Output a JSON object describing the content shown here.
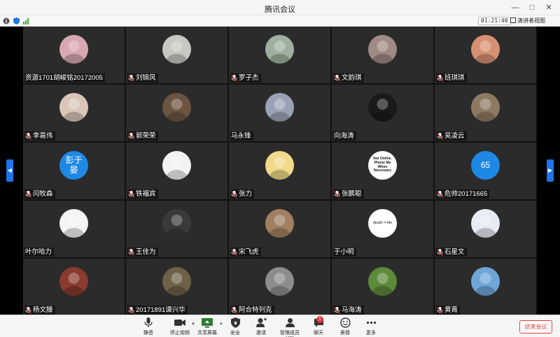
{
  "window": {
    "title": "腾讯会议"
  },
  "status": {
    "timer": "01:21:40",
    "presenter_view_label": "演讲者视图"
  },
  "participants": [
    {
      "name": "资源1701胡峻铭20172005",
      "muted": false,
      "avatar_text": "",
      "avatar_color": "#d7a7b2"
    },
    {
      "name": "刘锦风",
      "muted": true,
      "avatar_text": "",
      "avatar_color": "#c9c7c3"
    },
    {
      "name": "罗子杰",
      "muted": true,
      "avatar_text": "",
      "avatar_color": "#9fb0a1"
    },
    {
      "name": "文韵琪",
      "muted": true,
      "avatar_text": "",
      "avatar_color": "#a08a84"
    },
    {
      "name": "班琪琪",
      "muted": true,
      "avatar_text": "",
      "avatar_color": "#d79072"
    },
    {
      "name": "李嘉伟",
      "muted": true,
      "avatar_text": "",
      "avatar_color": "#d9c6b9"
    },
    {
      "name": "郭荣荣",
      "muted": true,
      "avatar_text": "",
      "avatar_color": "#6c5540"
    },
    {
      "name": "马永锋",
      "muted": false,
      "avatar_text": "",
      "avatar_color": "#9aa3b5"
    },
    {
      "name": "向海涛",
      "muted": false,
      "avatar_text": "",
      "avatar_color": "#1a1a1a"
    },
    {
      "name": "吴凌云",
      "muted": true,
      "avatar_text": "",
      "avatar_color": "#8e7a62"
    },
    {
      "name": "闫牧森",
      "muted": true,
      "avatar_text": "彭于晏",
      "avatar_color": "#1e88e5"
    },
    {
      "name": "铁福宾",
      "muted": true,
      "avatar_text": "",
      "avatar_color": "#f2f2f2"
    },
    {
      "name": "张力",
      "muted": true,
      "avatar_text": "",
      "avatar_color": "#f0d98a"
    },
    {
      "name": "张鹏聪",
      "muted": true,
      "avatar_text": "Not Online. Phone Me When Necessary",
      "avatar_color": "#ffffff"
    },
    {
      "name": "危帅20171665",
      "muted": true,
      "avatar_text": "65",
      "avatar_color": "#1e88e5"
    },
    {
      "name": "叶尔哈力",
      "muted": false,
      "avatar_text": "",
      "avatar_color": "#f4f4f4"
    },
    {
      "name": "王佳为",
      "muted": true,
      "avatar_text": "",
      "avatar_color": "#3a3a3a"
    },
    {
      "name": "宋飞虎",
      "muted": true,
      "avatar_text": "",
      "avatar_color": "#a08060"
    },
    {
      "name": "于小明",
      "muted": false,
      "avatar_text": "death = life",
      "avatar_color": "#ffffff"
    },
    {
      "name": "石星文",
      "muted": true,
      "avatar_text": "",
      "avatar_color": "#e8eaf4"
    },
    {
      "name": "杨文滕",
      "muted": true,
      "avatar_text": "",
      "avatar_color": "#8a3a2e"
    },
    {
      "name": "20171891谭兴华",
      "muted": true,
      "avatar_text": "",
      "avatar_color": "#6d6148"
    },
    {
      "name": "阿合特列克",
      "muted": true,
      "avatar_text": "",
      "avatar_color": "#8d8d8d"
    },
    {
      "name": "马海涛",
      "muted": true,
      "avatar_text": "",
      "avatar_color": "#5d8a3a"
    },
    {
      "name": "黄菁",
      "muted": true,
      "avatar_text": "",
      "avatar_color": "#6fa6d8"
    }
  ],
  "toolbar": {
    "mute_label": "静音",
    "stop_video_label": "停止视频",
    "share_screen_label": "共享屏幕",
    "security_label": "安全",
    "invite_label": "邀请",
    "manage_members_label": "管理成员(45)",
    "chat_label": "聊天",
    "chat_badge": "1",
    "reactions_label": "表情",
    "more_label": "更多",
    "end_meeting_label": "结束会议"
  },
  "colors": {
    "accent": "#1e74e8",
    "end_red": "#e0413a",
    "tile_bg": "#2b2b2b"
  }
}
